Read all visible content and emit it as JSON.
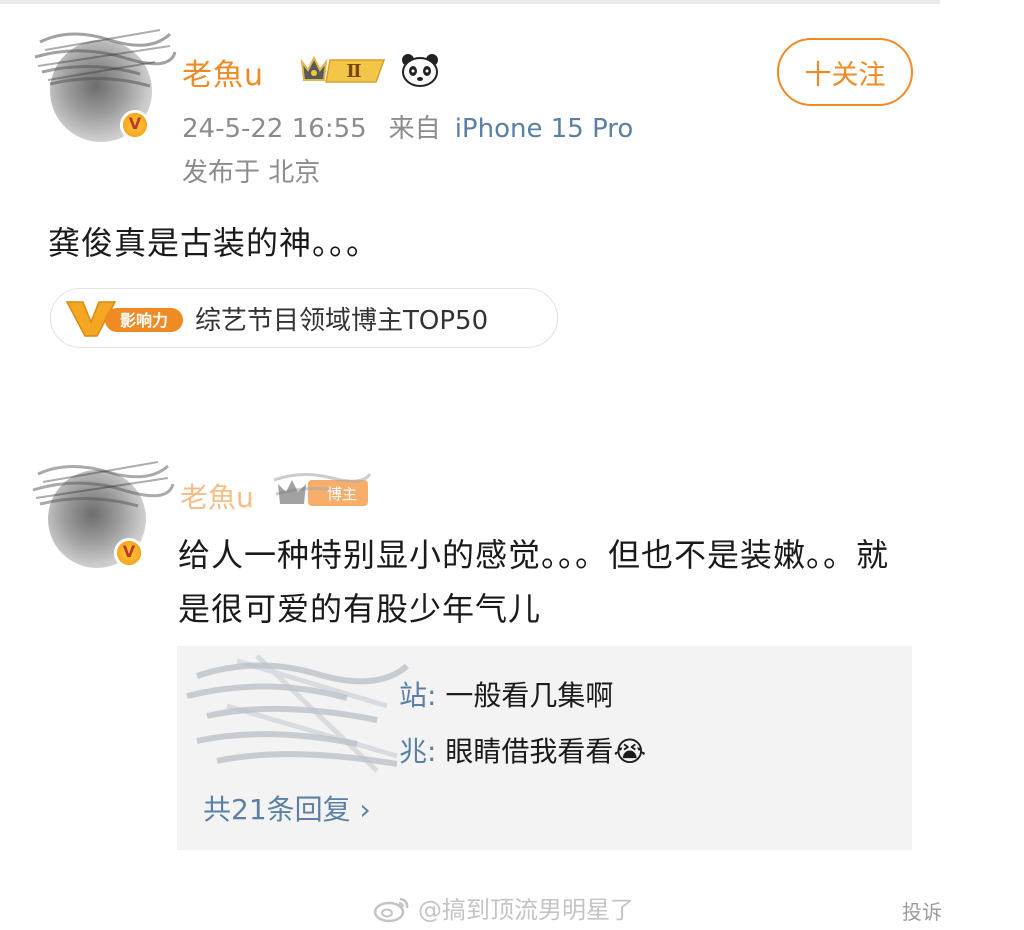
{
  "post": {
    "author": "老魚u",
    "rank_label": "Ⅱ",
    "follow_label": "十关注",
    "date": "24-5-22 16:55",
    "source_prefix": "来自",
    "device": "iPhone 15 Pro",
    "location": "发布于 北京",
    "text": "龚俊真是古装的神。。。",
    "influence": {
      "badge_label": "影响力",
      "text": "综艺节目领域博主TOP50"
    }
  },
  "comment": {
    "author": "老魚u",
    "badge_label": "博主",
    "text": "给人一种特别显小的感觉。。。但也不是装嫩。。就是很可爱的有股少年气儿",
    "replies": [
      {
        "name_suffix": "站:",
        "text": " 一般看几集啊"
      },
      {
        "name_suffix": "兆:",
        "text": " 眼睛借我看看😭"
      }
    ],
    "more_replies": "共21条回复 ›"
  },
  "footer": {
    "watermark": "@搞到顶流男明星了",
    "report": "投诉"
  },
  "colors": {
    "accent": "#f08a24",
    "link": "#5b7fa6",
    "meta": "#8c8c8c",
    "reply_bg": "#f3f3f3"
  }
}
